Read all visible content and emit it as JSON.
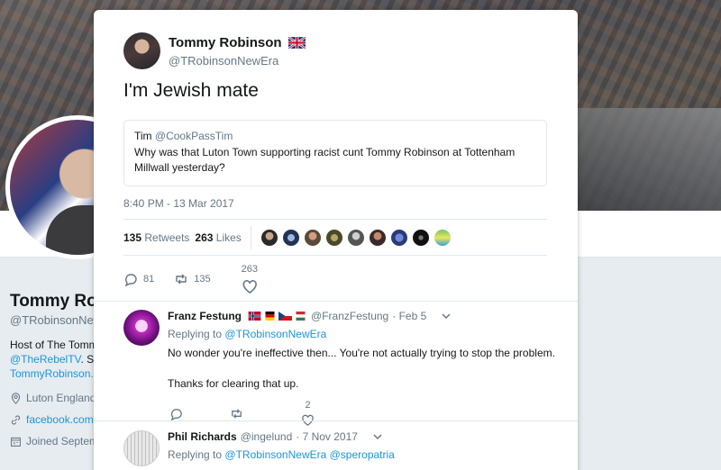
{
  "profile": {
    "name": "Tommy Rob",
    "handle": "@TRobinsonNew",
    "bio_line1": "Host of The Tomm",
    "bio_link1": "@TheRebelTV",
    "bio_link1_rest": ". S",
    "bio_link2": "TommyRobinson.c",
    "location": "Luton England",
    "website": "facebook.com",
    "joined": "Joined Septem"
  },
  "tweet": {
    "author_name": "Tommy Robinson",
    "author_handle": "@TRobinsonNewEra",
    "text": "I'm Jewish mate",
    "quote": {
      "name": "Tim",
      "handle": "@CookPassTim",
      "text": "Why was that Luton Town supporting racist cunt Tommy Robinson at Tottenham Millwall yesterday?"
    },
    "timestamp": "8:40 PM - 13 Mar 2017",
    "retweets_count": "135",
    "retweets_label": "Retweets",
    "likes_count": "263",
    "likes_label": "Likes",
    "actions": {
      "replies": "81",
      "retweets": "135",
      "likes": "263"
    }
  },
  "replies": [
    {
      "name": "Franz Festung",
      "handle": "@FranzFestung",
      "date": "· Feb 5",
      "replying_prefix": "Replying to",
      "replying_to": "@TRobinsonNewEra",
      "text1": "No wonder you're ineffective then... You're not actually trying to stop the problem.",
      "text2": "Thanks for clearing that up.",
      "likes": "2"
    },
    {
      "name": "Phil Richards",
      "handle": "@ingelund",
      "date": "· 7 Nov 2017",
      "replying_prefix": "Replying to",
      "replying_to": "@TRobinsonNewEra @speropatria"
    }
  ],
  "colors": {
    "accent": "#1b95e0",
    "muted": "#657786",
    "border": "#e1e8ed"
  }
}
